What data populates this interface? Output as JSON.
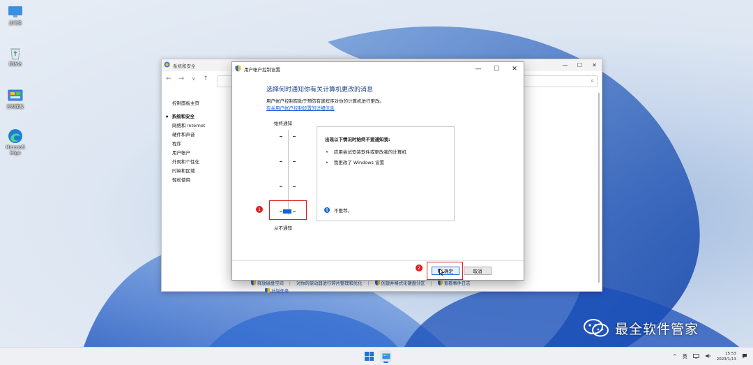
{
  "desktop": {
    "icons": [
      {
        "label": "此电脑",
        "icon": "monitor-icon"
      },
      {
        "label": "回收站",
        "icon": "recycle-bin-icon"
      },
      {
        "label": "控制面板",
        "icon": "control-panel-icon"
      },
      {
        "label": "Microsoft Edge",
        "icon": "edge-icon"
      }
    ]
  },
  "control_panel": {
    "title": "系统和安全",
    "sidebar": {
      "home": "控制面板主页",
      "items": [
        "系统和安全",
        "网络和 Internet",
        "硬件和声音",
        "程序",
        "用户帐户",
        "外观和个性化",
        "时钟和区域",
        "轻松使用"
      ]
    },
    "links": [
      "释放磁盘空间",
      "对你的驱动器进行碎片整理和优化",
      "创建并格式化硬盘分区",
      "查看事件日志",
      "计划任务"
    ]
  },
  "uac": {
    "title": "用户帐户控制设置",
    "heading": "选择何时通知你有关计算机更改的消息",
    "description": "用户帐户控制有助于预防有害程序对你的计算机进行更改。",
    "more_link": "有关用户帐户控制设置的详细信息",
    "slider": {
      "top_label": "始终通知",
      "bottom_label": "从不通知",
      "level": 0,
      "levels": 4
    },
    "info": {
      "heading": "出现以下情况时始终不要通知我:",
      "bullets": [
        "应用尝试安装软件或更改我的计算机",
        "我更改了 Windows 设置"
      ],
      "note": "不推荐。"
    },
    "buttons": {
      "ok": "确定",
      "cancel": "取消"
    },
    "annotations": [
      "1",
      "2"
    ]
  },
  "watermark": "最全软件管家",
  "taskbar": {
    "tray_chevron": "^",
    "ime": "英",
    "time": "15:53",
    "date": "2023/1/13"
  },
  "colors": {
    "accent": "#0a63d9",
    "annotation": "#e02020",
    "link": "#1f5fd1"
  }
}
